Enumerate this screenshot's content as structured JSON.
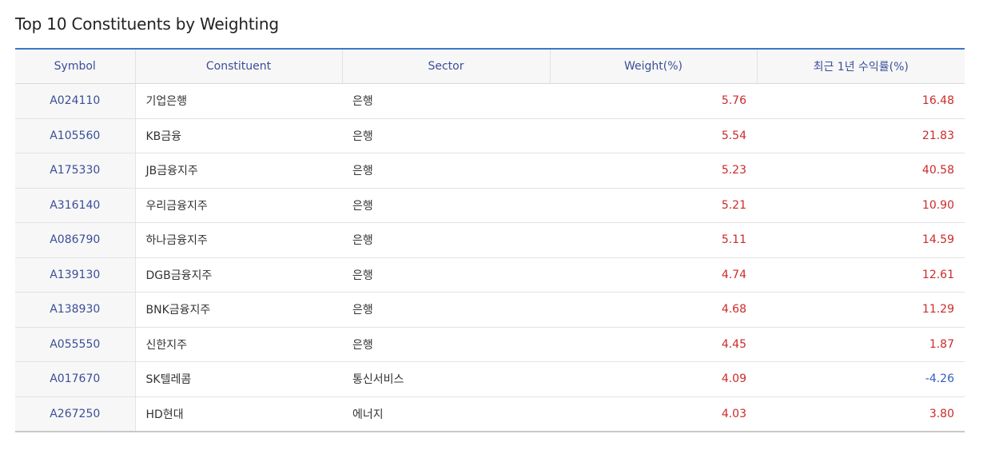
{
  "title": "Top 10 Constituents by Weighting",
  "columns": {
    "symbol": "Symbol",
    "constituent": "Constituent",
    "sector": "Sector",
    "weight": "Weight(%)",
    "return_1y": "최근 1년 수익률(%)"
  },
  "colors": {
    "header_border": "#3b78c9",
    "symbol_text": "#3a4f99",
    "positive": "#cc2a2a",
    "negative": "#2f5fc0"
  },
  "rows": [
    {
      "symbol": "A024110",
      "constituent": "기업은행",
      "sector": "은행",
      "weight": "5.76",
      "return_1y": "16.48"
    },
    {
      "symbol": "A105560",
      "constituent": "KB금융",
      "sector": "은행",
      "weight": "5.54",
      "return_1y": "21.83"
    },
    {
      "symbol": "A175330",
      "constituent": "JB금융지주",
      "sector": "은행",
      "weight": "5.23",
      "return_1y": "40.58"
    },
    {
      "symbol": "A316140",
      "constituent": "우리금융지주",
      "sector": "은행",
      "weight": "5.21",
      "return_1y": "10.90"
    },
    {
      "symbol": "A086790",
      "constituent": "하나금융지주",
      "sector": "은행",
      "weight": "5.11",
      "return_1y": "14.59"
    },
    {
      "symbol": "A139130",
      "constituent": "DGB금융지주",
      "sector": "은행",
      "weight": "4.74",
      "return_1y": "12.61"
    },
    {
      "symbol": "A138930",
      "constituent": "BNK금융지주",
      "sector": "은행",
      "weight": "4.68",
      "return_1y": "11.29"
    },
    {
      "symbol": "A055550",
      "constituent": "신한지주",
      "sector": "은행",
      "weight": "4.45",
      "return_1y": "1.87"
    },
    {
      "symbol": "A017670",
      "constituent": "SK텔레콤",
      "sector": "통신서비스",
      "weight": "4.09",
      "return_1y": "-4.26"
    },
    {
      "symbol": "A267250",
      "constituent": "HD현대",
      "sector": "에너지",
      "weight": "4.03",
      "return_1y": "3.80"
    }
  ]
}
